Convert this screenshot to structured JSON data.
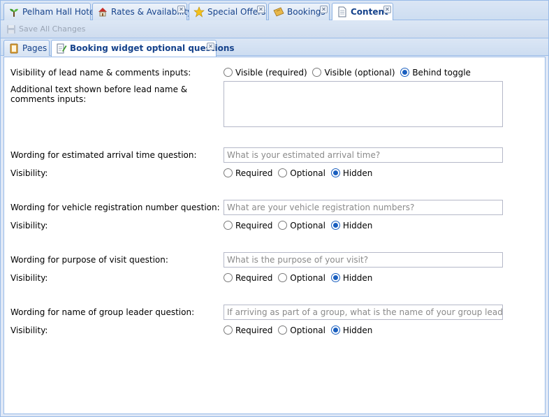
{
  "top_tabs": [
    {
      "label": "Pelham Hall Hotel",
      "icon": "plant-icon"
    },
    {
      "label": "Rates & Availability",
      "icon": "house-icon"
    },
    {
      "label": "Special Offers",
      "icon": "star-icon"
    },
    {
      "label": "Bookings",
      "icon": "ticket-icon"
    },
    {
      "label": "Content",
      "icon": "document-icon"
    }
  ],
  "toolbar": {
    "save_label": "Save All Changes"
  },
  "sub_tabs": [
    {
      "label": "Pages",
      "icon": "pages-icon"
    },
    {
      "label": "Booking widget optional questions",
      "icon": "edit-document-icon"
    }
  ],
  "form": {
    "lead": {
      "visibility_label": "Visibility of lead name & comments inputs:",
      "options": [
        "Visible (required)",
        "Visible (optional)",
        "Behind toggle"
      ],
      "selected": "Behind toggle",
      "text_label": "Additional text shown before lead name & comments inputs:",
      "text_value": ""
    },
    "questions": [
      {
        "wording_label": "Wording for estimated arrival time question:",
        "placeholder": "What is your estimated arrival time?",
        "visibility_label": "Visibility:",
        "options": [
          "Required",
          "Optional",
          "Hidden"
        ],
        "selected": "Hidden"
      },
      {
        "wording_label": "Wording for vehicle registration number question:",
        "placeholder": "What are your vehicle registration numbers?",
        "visibility_label": "Visibility:",
        "options": [
          "Required",
          "Optional",
          "Hidden"
        ],
        "selected": "Hidden"
      },
      {
        "wording_label": "Wording for purpose of visit question:",
        "placeholder": "What is the purpose of your visit?",
        "visibility_label": "Visibility:",
        "options": [
          "Required",
          "Optional",
          "Hidden"
        ],
        "selected": "Hidden"
      },
      {
        "wording_label": "Wording for name of group leader question:",
        "placeholder": "If arriving as part of a group, what is the name of your group leader?",
        "visibility_label": "Visibility:",
        "options": [
          "Required",
          "Optional",
          "Hidden"
        ],
        "selected": "Hidden"
      }
    ]
  },
  "colors": {
    "accent": "#15428b",
    "radio_selected": "#1a5fbf",
    "border": "#99bbe8"
  }
}
